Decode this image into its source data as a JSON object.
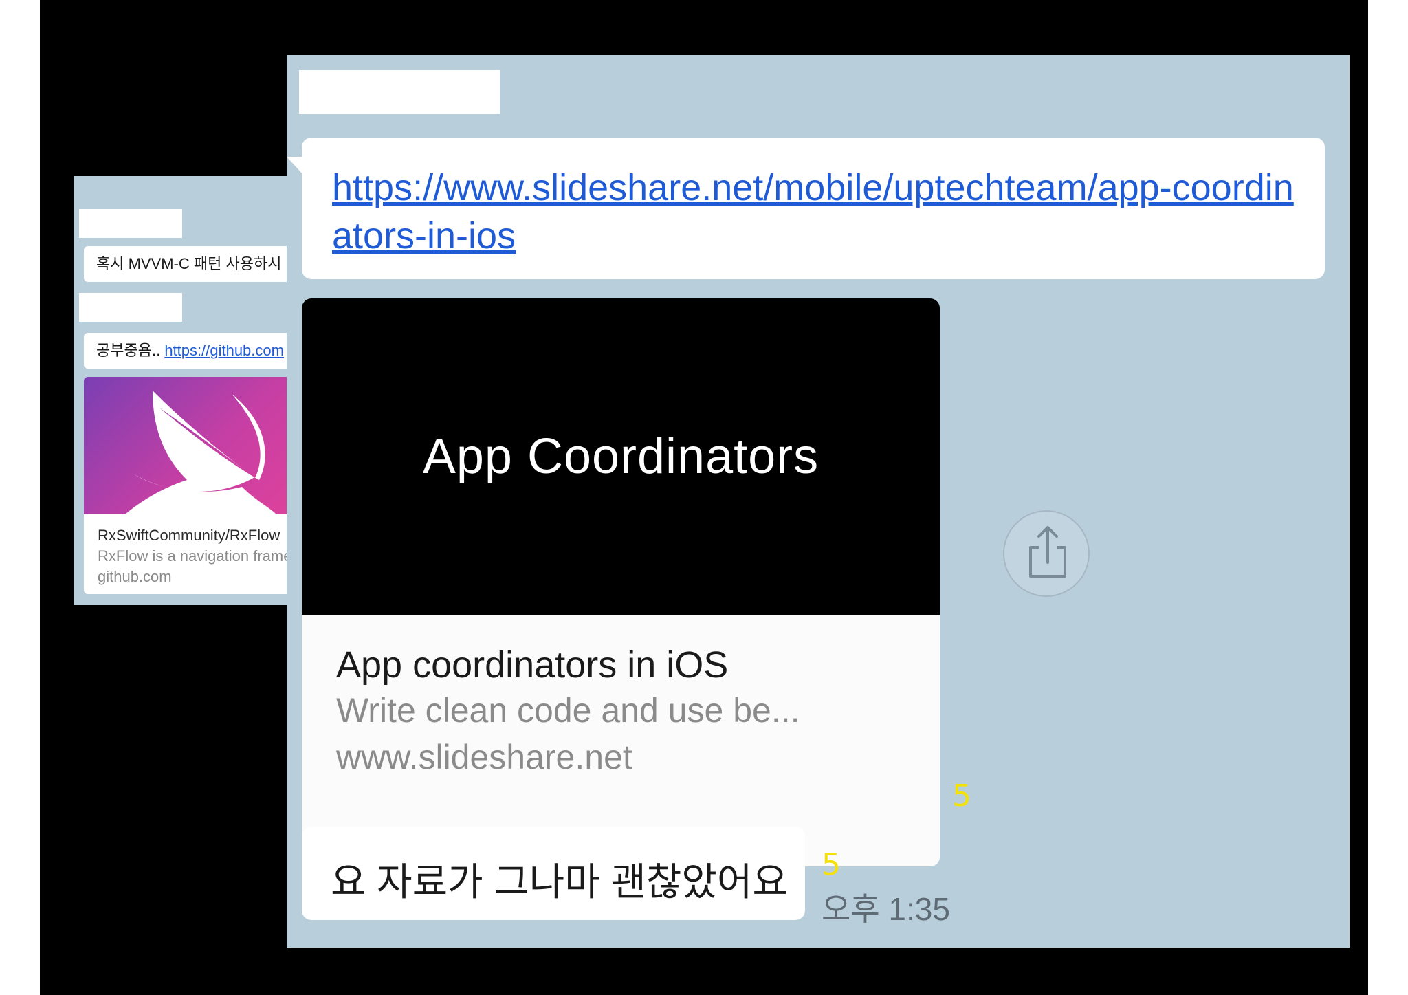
{
  "back_chat": {
    "message_1": "혹시 MVVM-C 패턴 사용하시",
    "message_2_prefix": "공부중욤..",
    "message_2_link": "https://github.com",
    "preview": {
      "title": "RxSwiftCommunity/RxFlow",
      "description": "RxFlow is a navigation framework",
      "domain": "github.com"
    }
  },
  "main_chat": {
    "link_message": "https://www.slideshare.net/mobile/uptechteam/app-coordinators-in-ios",
    "link_preview": {
      "image_title": "App Coordinators",
      "title": "App coordinators in iOS",
      "description": "Write clean code and use be...",
      "domain": "www.slideshare.net"
    },
    "unread_count_1": "5",
    "text_message": "요 자료가 그나마 괜찮았어요",
    "unread_count_2": "5",
    "timestamp": "오후 1:35",
    "share_icon": "share-icon"
  },
  "colors": {
    "chat_background": "#b9cedb",
    "link": "#1f5bd6",
    "unread": "#f5e10a",
    "frame": "#000000"
  }
}
